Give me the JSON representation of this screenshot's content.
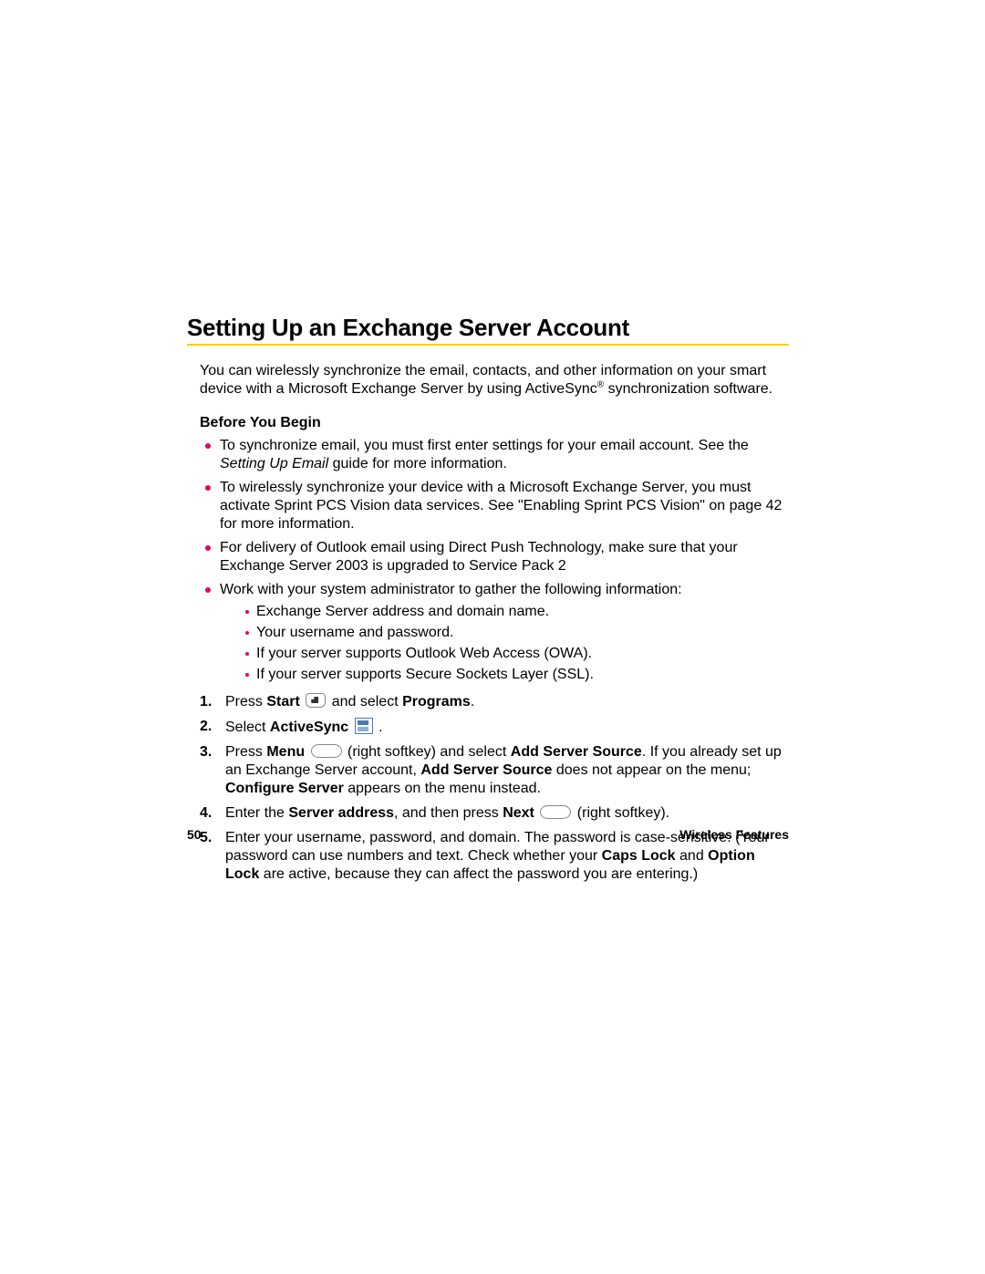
{
  "heading": "Setting Up an Exchange Server Account",
  "intro": {
    "line1": "You can wirelessly synchronize the email, contacts, and other information on your smart device with a Microsoft Exchange Server by using ActiveSync",
    "reg": "®",
    "line1_tail": " synchronization software."
  },
  "subheading": "Before You Begin",
  "bullets": {
    "b1_a": "To synchronize email, you must first enter settings for your email account. See the ",
    "b1_em": "Setting Up Email",
    "b1_b": " guide for more information.",
    "b2": "To wirelessly synchronize your device with a Microsoft Exchange Server, you must activate Sprint PCS Vision data services. See \"Enabling Sprint PCS Vision\" on page 42 for more information.",
    "b3": "For delivery of Outlook email using Direct Push Technology, make sure that your Exchange Server 2003 is upgraded to Service Pack 2",
    "b4": "Work with your system administrator to gather the following information:",
    "sub": {
      "s1": "Exchange Server address and domain name.",
      "s2": "Your username and password.",
      "s3": "If your server supports Outlook Web Access (OWA).",
      "s4": "If your server supports Secure Sockets Layer (SSL)."
    }
  },
  "steps": {
    "s1_a": "Press ",
    "s1_start": "Start",
    "s1_b": " and select ",
    "s1_programs": "Programs",
    "s1_c": ".",
    "s2_a": "Select ",
    "s2_activesync": "ActiveSync",
    "s2_b": " .",
    "s3_a": "Press ",
    "s3_menu": "Menu",
    "s3_b1": " (right softkey) and select ",
    "s3_addserver": "Add Server Source",
    "s3_b2": ". If you already set up an Exchange Server account, ",
    "s3_addserver2": "Add Server Source",
    "s3_b3": " does not appear on the menu; ",
    "s3_configure": "Configure Server",
    "s3_b4": " appears on the menu instead.",
    "s4_a": "Enter the ",
    "s4_serveraddr": "Server address",
    "s4_b": ", and then press ",
    "s4_next": "Next",
    "s4_c": " (right softkey).",
    "s5_a": "Enter your username, password, and domain. The password is case-sensitive. (Your password can use numbers and text. Check whether your ",
    "s5_caps": "Caps Lock",
    "s5_b": " and ",
    "s5_option": "Option Lock",
    "s5_c": " are active, because they can affect the password you are entering.)"
  },
  "footer": {
    "page": "50",
    "section": "Wireless Features"
  }
}
